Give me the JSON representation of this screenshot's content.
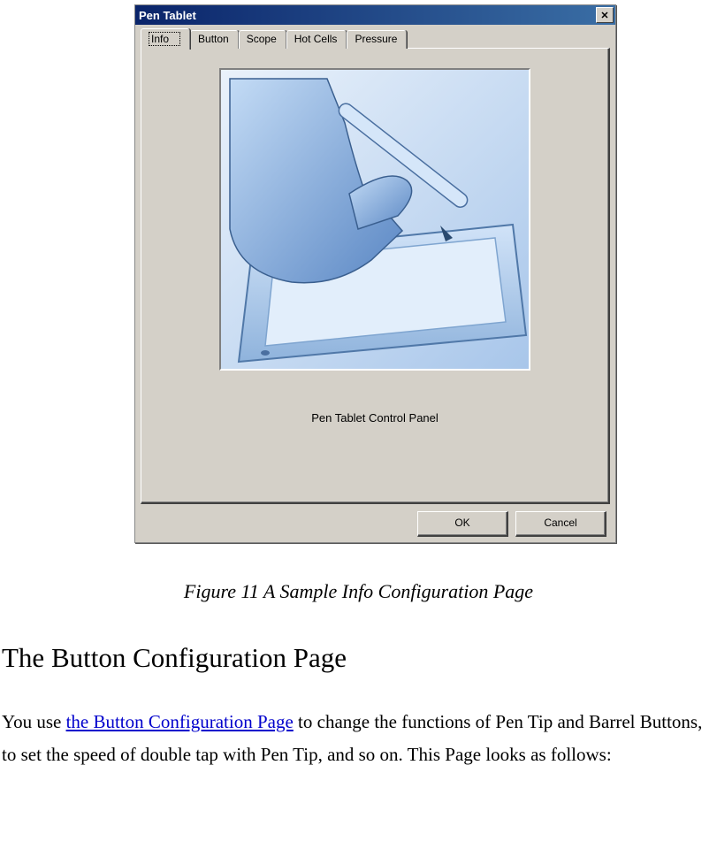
{
  "dialog": {
    "title": "Pen Tablet",
    "close_symbol": "✕",
    "tabs": [
      "Info",
      "Button",
      "Scope",
      "Hot Cells",
      "Pressure"
    ],
    "active_tab_index": 0,
    "panel_caption": "Pen Tablet Control Panel",
    "buttons": {
      "ok": "OK",
      "cancel": "Cancel"
    }
  },
  "figure_caption": "Figure 11 A Sample Info Configuration Page",
  "section_heading": "The Button Configuration Page",
  "paragraph": {
    "pre": "You use ",
    "link": "the Button Configuration Page",
    "post": " to change the functions of Pen Tip and Barrel Buttons, to set the speed of double tap with Pen Tip, and so on. This Page looks as follows:"
  }
}
